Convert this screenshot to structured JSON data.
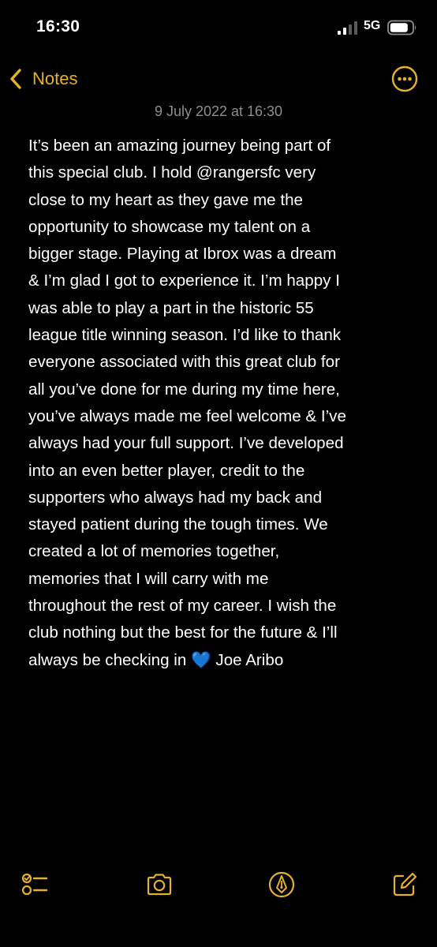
{
  "status_bar": {
    "time": "16:30",
    "network": "5G",
    "icons": [
      "signal-icon",
      "battery-icon"
    ]
  },
  "nav": {
    "back_label": "Notes",
    "icons": [
      "chevron-left-icon",
      "more-icon"
    ]
  },
  "note": {
    "date": "9 July 2022 at 16:30",
    "body": "It’s been an amazing journey being part of\nthis special club. I hold @rangersfc very\nclose to my heart as they gave me the\nopportunity to showcase my talent on a\nbigger stage. Playing at Ibrox was a dream\n& I’m glad I got to experience it. I’m happy I\nwas able to play a part in the historic 55\nleague title winning season. I’d like to thank\neveryone associated with this great club for\nall you’ve done for me during my time here,\nyou’ve always made me feel welcome & I’ve\nalways had your full support. I’ve developed\ninto an even better player, credit to the\nsupporters who always had my back and\nstayed patient during the tough times. We\ncreated a lot of memories together,\nmemories that I will carry with me\nthroughout the rest of my career. I wish the\nclub nothing but the best for the future & I’ll\nalways be checking in 💙 Joe Aribo"
  },
  "toolbar": {
    "icons": [
      "checklist-icon",
      "camera-icon",
      "markup-pen-icon",
      "compose-icon"
    ]
  },
  "colors": {
    "background": "#000000",
    "accent": "#e4b22c",
    "text": "#ffffff",
    "secondary_text": "#8e8e93"
  }
}
